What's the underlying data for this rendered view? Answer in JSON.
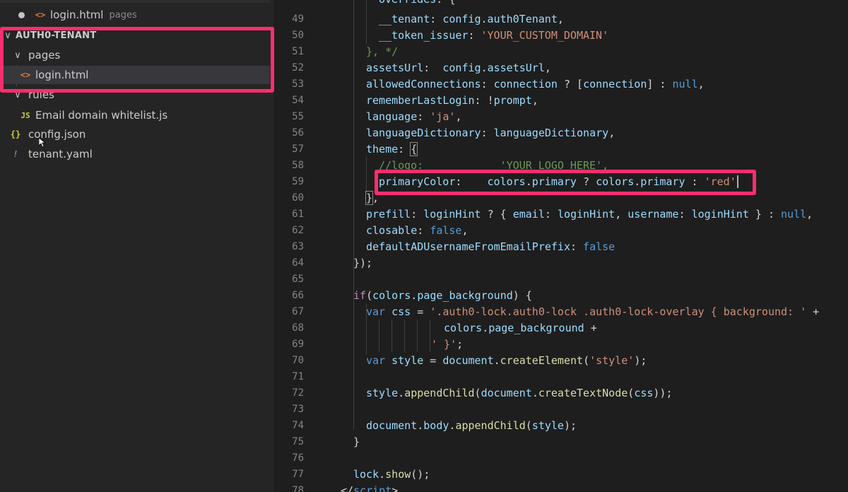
{
  "explorer": {
    "open_editor": {
      "name": "login.html",
      "folder": "pages"
    },
    "section_title": "AUTH0-TENANT",
    "items": [
      {
        "label": "pages",
        "type": "folder"
      },
      {
        "label": "login.html",
        "type": "html"
      },
      {
        "label": "rules",
        "type": "folder"
      },
      {
        "label": "Email domain whitelist.js",
        "type": "js"
      },
      {
        "label": "config.json",
        "type": "json"
      },
      {
        "label": "tenant.yaml",
        "type": "yaml"
      }
    ]
  },
  "icons": {
    "html": "<>",
    "js": "JS",
    "json": "{}",
    "yaml": "!",
    "chevron": "chevron-down-icon",
    "dot": "unsaved-dot-icon"
  },
  "colors": {
    "annotation": "#ff2d6e",
    "keyword": "#569cd6",
    "string": "#ce9178",
    "property": "#9cdcfe",
    "function": "#dcdcaa",
    "comment": "#6a9955"
  },
  "editor": {
    "line_numbers": [
      "49",
      "50",
      "51",
      "52",
      "53",
      "54",
      "55",
      "56",
      "57",
      "58",
      "59",
      "60",
      "61",
      "62",
      "63",
      "64",
      "65",
      "66",
      "67",
      "68",
      "69",
      "70",
      "71",
      "72",
      "73",
      "74",
      "75",
      "76",
      "77",
      "78"
    ]
  }
}
